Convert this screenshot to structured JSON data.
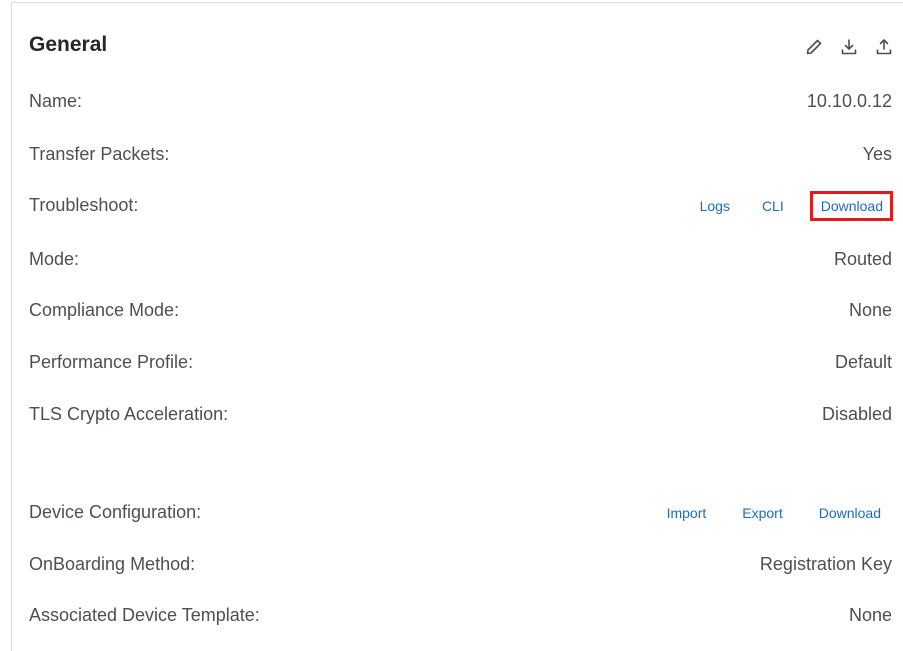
{
  "header": {
    "title": "General",
    "icons": [
      "pencil-icon",
      "download-icon",
      "upload-icon"
    ]
  },
  "rows": {
    "name": {
      "label": "Name:",
      "value": "10.10.0.12"
    },
    "transfer_packets": {
      "label": "Transfer Packets:",
      "value": "Yes"
    },
    "troubleshoot": {
      "label": "Troubleshoot:",
      "links": [
        "Logs",
        "CLI",
        "Download"
      ]
    },
    "mode": {
      "label": "Mode:",
      "value": "Routed"
    },
    "compliance_mode": {
      "label": "Compliance Mode:",
      "value": "None"
    },
    "performance_profile": {
      "label": "Performance Profile:",
      "value": "Default"
    },
    "tls_crypto": {
      "label": "TLS Crypto Acceleration:",
      "value": "Disabled"
    },
    "device_configuration": {
      "label": "Device Configuration:",
      "links": [
        "Import",
        "Export",
        "Download"
      ]
    },
    "onboarding_method": {
      "label": "OnBoarding Method:",
      "value": "Registration Key"
    },
    "associated_template": {
      "label": "Associated Device Template:",
      "value": "None"
    }
  },
  "colors": {
    "link": "#1a6cc5",
    "highlight_box": "#e31b1b",
    "text": "#4a5056",
    "title": "#23282d"
  }
}
